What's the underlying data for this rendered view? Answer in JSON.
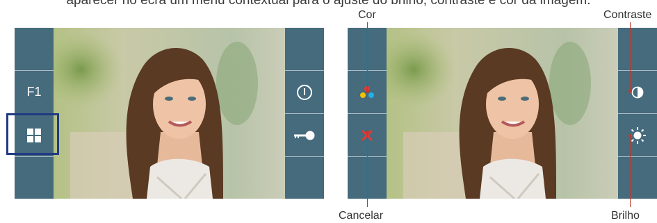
{
  "caption": "aparecer no ecrã um menu contextual para o ajuste do brilho, contraste e cor da imagem.",
  "left_panel": {
    "left_buttons": {
      "f1_label": "F1"
    }
  },
  "right_panel": {
    "callouts": {
      "cor": "Cor",
      "contraste": "Contraste",
      "cancelar": "Cancelar",
      "brilho": "Brilho"
    }
  },
  "colors": {
    "sidebar": "#456b7d",
    "highlight_frame": "#223a82",
    "cancel_x": "#e53935",
    "callout_line": "#c0392b"
  },
  "icons": [
    "apps-grid-icon",
    "power-icon",
    "key-icon",
    "color-dots-icon",
    "close-icon",
    "contrast-icon",
    "brightness-icon"
  ]
}
